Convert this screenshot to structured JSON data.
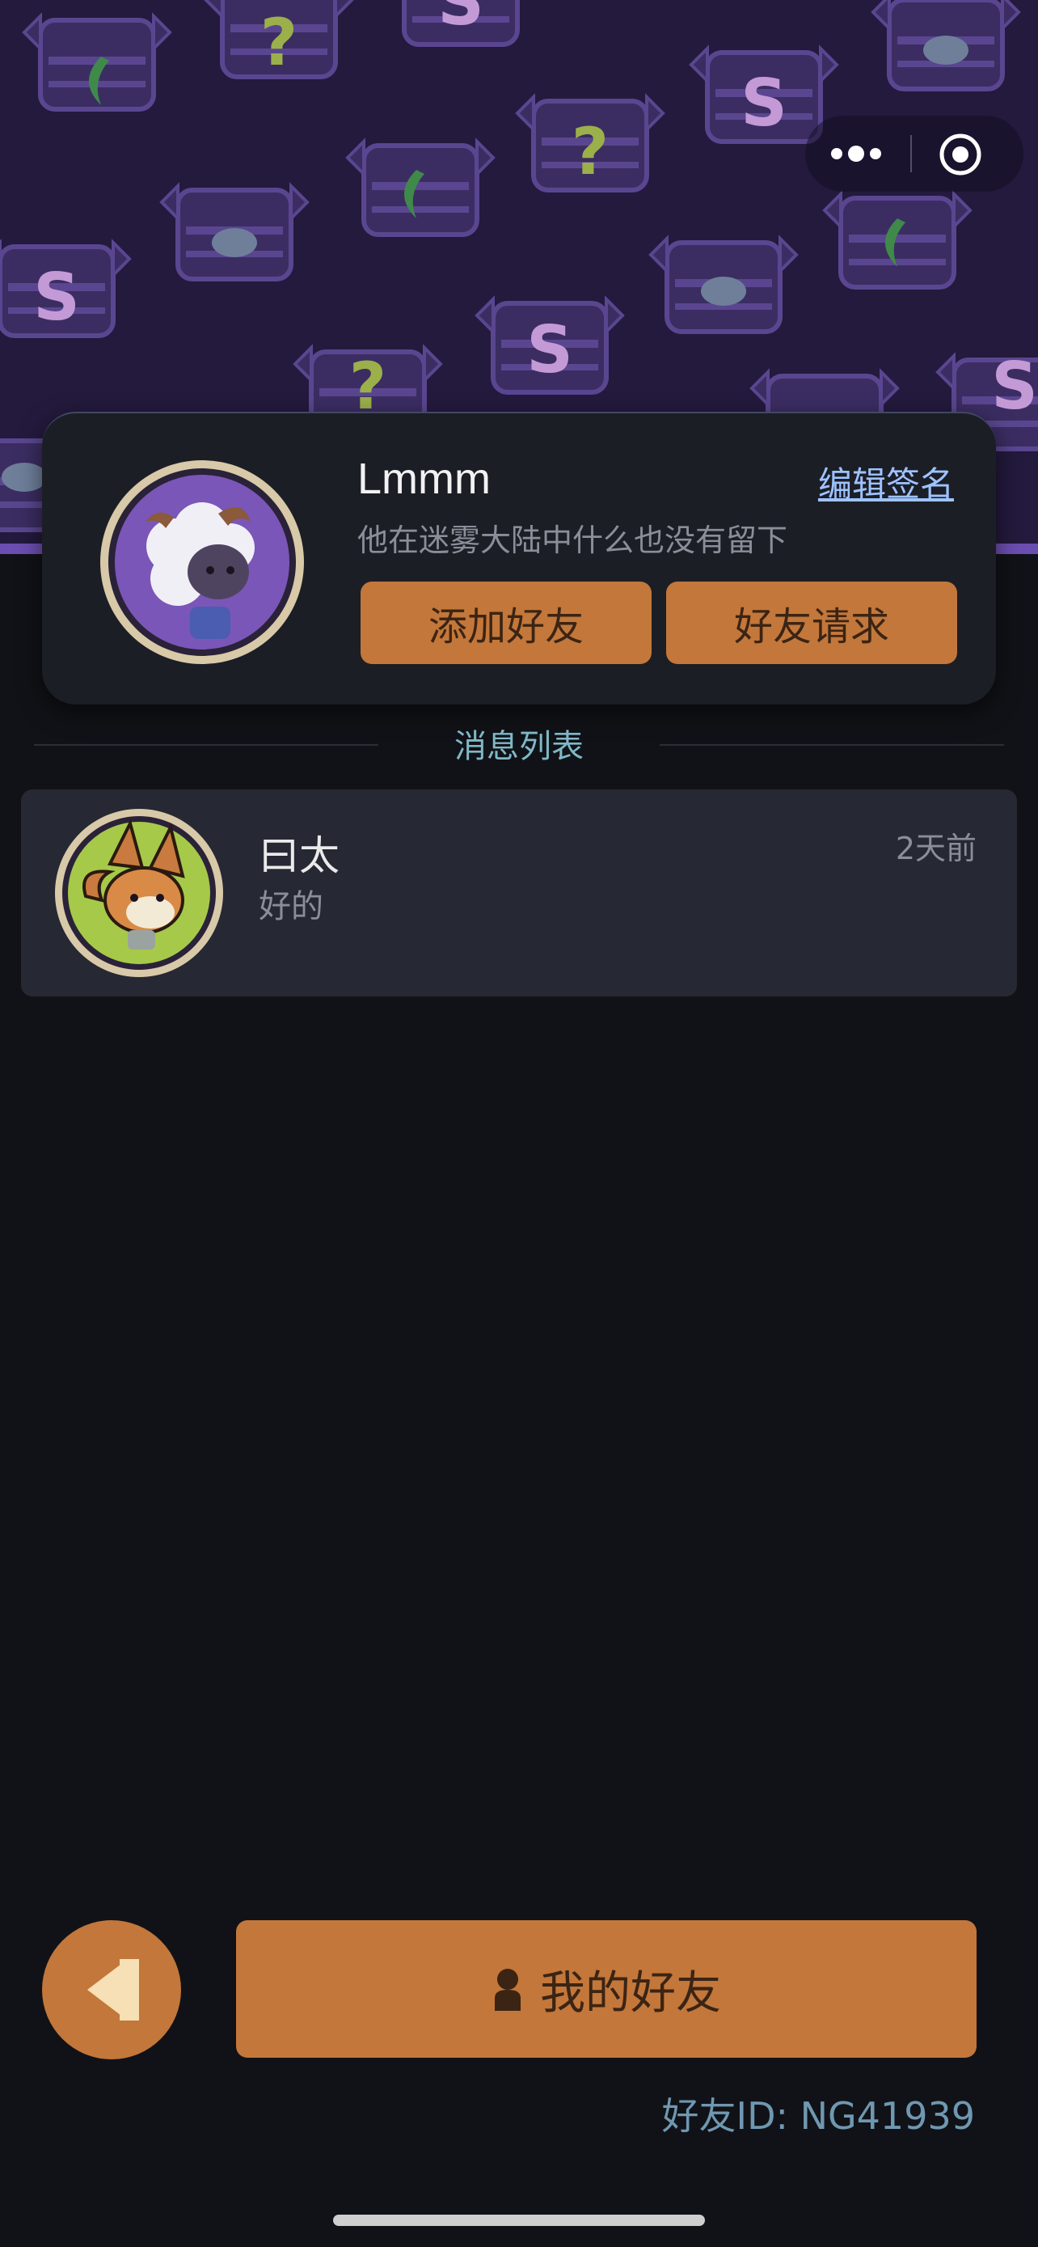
{
  "top_capsule": {
    "more_icon": "more-dots-icon",
    "record_icon": "record-target-icon"
  },
  "profile": {
    "name": "Lmmm",
    "signature": "他在迷雾大陆中什么也没有留下",
    "edit_signature_label": "编辑签名",
    "add_friend_label": "添加好友",
    "friend_request_label": "好友请求",
    "avatar_icon": "sheep-avatar-icon"
  },
  "messages": {
    "section_title": "消息列表",
    "items": [
      {
        "name": "曰太",
        "preview": "好的",
        "time": "2天前",
        "avatar_icon": "fox-avatar-icon"
      }
    ]
  },
  "bottom": {
    "back_icon": "back-arrow-icon",
    "my_friends_label": "我的好友",
    "friend_id": "好友ID: NG41939"
  },
  "colors": {
    "background": "#111217",
    "banner": "#231a3d",
    "accent_orange": "#c3773a",
    "card": "#1c1e26",
    "section_title": "#7fb8c7",
    "link": "#9ec3ff"
  }
}
